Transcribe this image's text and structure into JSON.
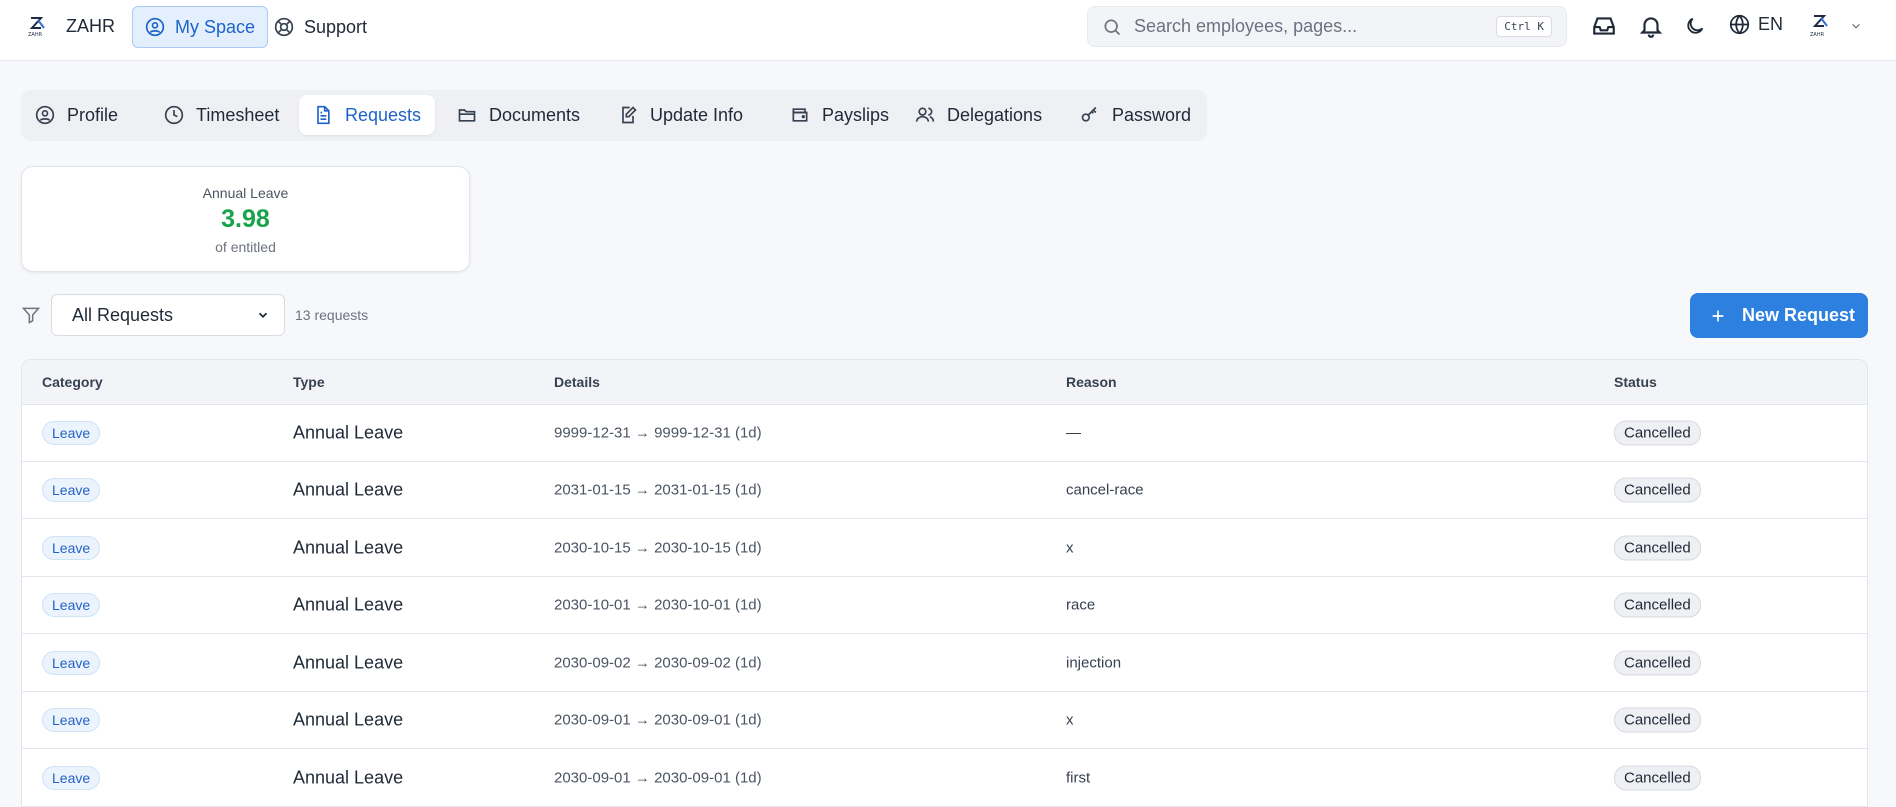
{
  "brand": {
    "name": "ZAHR",
    "logo_text": "ZAHR"
  },
  "nav": [
    {
      "label": "My Space",
      "icon": "user-circle-icon",
      "active": true
    },
    {
      "label": "Support",
      "icon": "lifebuoy-icon",
      "active": false
    }
  ],
  "search": {
    "placeholder": "Search employees, pages...",
    "shortcut": "Ctrl K"
  },
  "header_icons": [
    "inbox-icon",
    "bell-icon",
    "moon-icon",
    "globe-icon"
  ],
  "language": "EN",
  "tabs": [
    {
      "label": "Profile",
      "icon": "user-circle-icon"
    },
    {
      "label": "Timesheet",
      "icon": "clock-icon"
    },
    {
      "label": "Requests",
      "icon": "document-icon",
      "active": true
    },
    {
      "label": "Documents",
      "icon": "folder-icon"
    },
    {
      "label": "Update Info",
      "icon": "edit-icon"
    },
    {
      "label": "Payslips",
      "icon": "wallet-icon"
    },
    {
      "label": "Delegations",
      "icon": "users-icon"
    },
    {
      "label": "Password",
      "icon": "key-icon"
    }
  ],
  "leave_card": {
    "title": "Annual Leave",
    "value": "3.98",
    "subtitle": "of entitled"
  },
  "filter": {
    "selected": "All Requests",
    "count": "13 requests"
  },
  "new_request_label": "New Request",
  "table": {
    "columns": [
      "Category",
      "Type",
      "Details",
      "Reason",
      "Status"
    ],
    "rows": [
      {
        "category": "Leave",
        "type": "Annual Leave",
        "details": "9999-12-31 → 9999-12-31 (1d)",
        "reason": "—",
        "status": "Cancelled"
      },
      {
        "category": "Leave",
        "type": "Annual Leave",
        "details": "2031-01-15 → 2031-01-15 (1d)",
        "reason": "cancel-race",
        "status": "Cancelled"
      },
      {
        "category": "Leave",
        "type": "Annual Leave",
        "details": "2030-10-15 → 2030-10-15 (1d)",
        "reason": "x",
        "status": "Cancelled"
      },
      {
        "category": "Leave",
        "type": "Annual Leave",
        "details": "2030-10-01 → 2030-10-01 (1d)",
        "reason": "race",
        "status": "Cancelled"
      },
      {
        "category": "Leave",
        "type": "Annual Leave",
        "details": "2030-09-02 → 2030-09-02 (1d)",
        "reason": "injection",
        "status": "Cancelled"
      },
      {
        "category": "Leave",
        "type": "Annual Leave",
        "details": "2030-09-01 → 2030-09-01 (1d)",
        "reason": "x",
        "status": "Cancelled"
      },
      {
        "category": "Leave",
        "type": "Annual Leave",
        "details": "2030-09-01 → 2030-09-01 (1d)",
        "reason": "first",
        "status": "Cancelled"
      }
    ]
  },
  "colors": {
    "accent": "#2d7fe0",
    "leave_value": "#17a34a",
    "active_tab_text": "#1e63c9"
  }
}
